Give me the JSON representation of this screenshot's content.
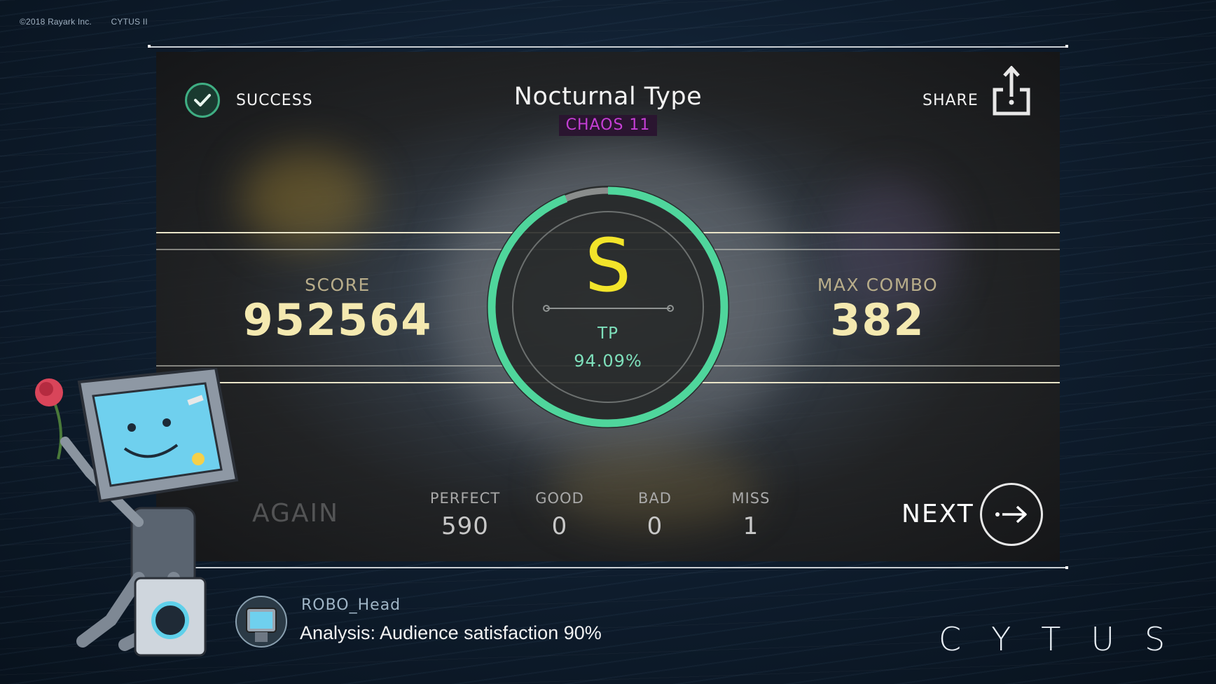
{
  "copyright": {
    "company": "©2018 Rayark Inc.",
    "game": "CYTUS II"
  },
  "header": {
    "status": "SUCCESS",
    "song_title": "Nocturnal Type",
    "difficulty": "CHAOS 11",
    "share_label": "SHARE"
  },
  "result": {
    "score_label": "SCORE",
    "score": "952564",
    "max_combo_label": "MAX COMBO",
    "max_combo": "382",
    "grade": "S",
    "tp_label": "TP",
    "tp_value": "94.09%",
    "tp_fraction": 0.9409
  },
  "judgements": [
    {
      "label": "PERFECT",
      "value": "590"
    },
    {
      "label": "GOOD",
      "value": "0"
    },
    {
      "label": "BAD",
      "value": "0"
    },
    {
      "label": "MISS",
      "value": "1"
    }
  ],
  "actions": {
    "again_label": "AGAIN",
    "next_label": "NEXT"
  },
  "dialog": {
    "speaker": "ROBO_Head",
    "message": "Analysis: Audience satisfaction 90%"
  },
  "logo_letters": [
    "C",
    "Y",
    "T",
    "U",
    "S"
  ],
  "colors": {
    "accent_green": "#4fd69c",
    "grade_yellow": "#f2e42a",
    "difficulty_purple": "#c63fd6",
    "score_text": "#f4e9b0"
  }
}
